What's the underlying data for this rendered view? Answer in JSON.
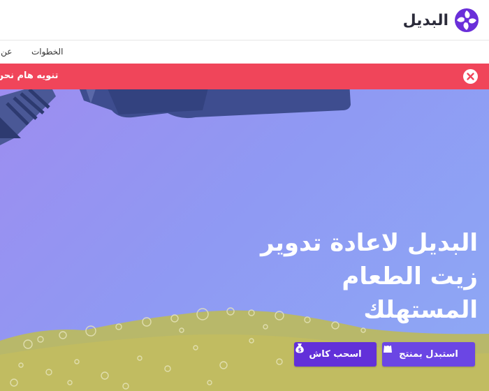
{
  "header": {
    "logo_text": "البديل",
    "logo_icon": "swirl-logo-icon",
    "brand_color": "#6a2fd9"
  },
  "nav": {
    "items": [
      {
        "label": "الخطوات"
      },
      {
        "label": "عن ا"
      }
    ]
  },
  "alert": {
    "text": "تنويه هام نحن",
    "background": "#f0455a",
    "close_icon": "close-circle-icon"
  },
  "hero": {
    "title_lines": [
      "البديل لاعادة تدوير",
      "زيت الطعام",
      "المستهلك"
    ],
    "buttons": [
      {
        "label": "استبدل بمنتج",
        "icon": "shopping-bag-icon",
        "color": "#6b46e4"
      },
      {
        "label": "اسحب كاش",
        "icon": "money-bag-icon",
        "color": "#6230d9"
      }
    ]
  }
}
